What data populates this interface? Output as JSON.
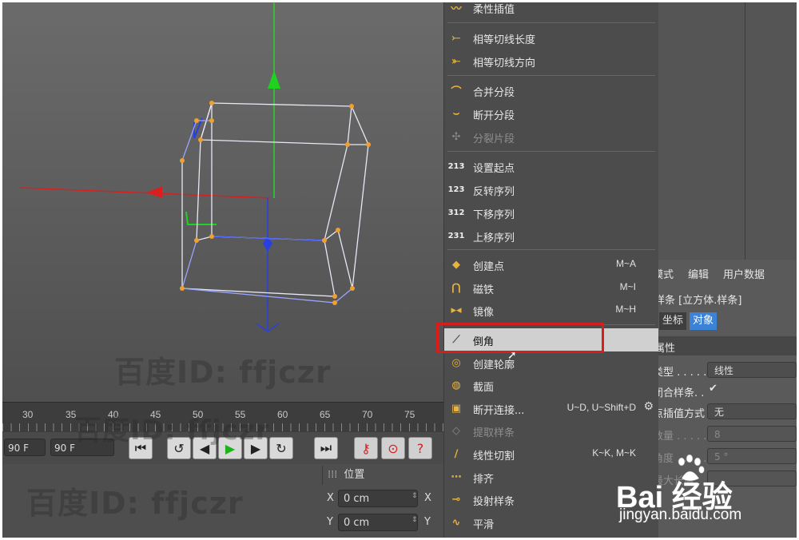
{
  "viewport": {
    "watermarks": [
      "百度ID: ffjczr",
      "百度ID: ffjczr",
      "百度ID: ffjczr"
    ]
  },
  "timeline": {
    "ticks": [
      "30",
      "35",
      "40",
      "45",
      "50",
      "55",
      "60",
      "65",
      "70",
      "75"
    ]
  },
  "controls": {
    "frame_start": "90 F",
    "frame_end": "90 F"
  },
  "coords": {
    "header": "位置",
    "rows": [
      {
        "axis": "X",
        "value": "0 cm"
      },
      {
        "axis": "Y",
        "value": "0 cm"
      }
    ]
  },
  "menu": {
    "items": [
      {
        "label": "柔性插值",
        "shortcut": "",
        "icon": "spline-soft-icon",
        "glyph": "〰",
        "disabled": false
      },
      {
        "label": "相等切线长度",
        "shortcut": "",
        "icon": "equal-tangent-length-icon",
        "glyph": "⤚",
        "disabled": false
      },
      {
        "label": "相等切线方向",
        "shortcut": "",
        "icon": "equal-tangent-direction-icon",
        "glyph": "⤜",
        "disabled": false
      },
      {
        "label": "合并分段",
        "shortcut": "",
        "icon": "join-segment-icon",
        "glyph": "⌒",
        "disabled": false
      },
      {
        "label": "断开分段",
        "shortcut": "",
        "icon": "break-segment-icon",
        "glyph": "⌣",
        "disabled": false
      },
      {
        "label": "分裂片段",
        "shortcut": "",
        "icon": "explode-segments-icon",
        "glyph": "✣",
        "disabled": true
      },
      {
        "label": "设置起点",
        "shortcut": "",
        "icon": "set-first-point-icon",
        "glyph": "213",
        "disabled": false
      },
      {
        "label": "反转序列",
        "shortcut": "",
        "icon": "reverse-sequence-icon",
        "glyph": "123",
        "disabled": false
      },
      {
        "label": "下移序列",
        "shortcut": "",
        "icon": "move-down-sequence-icon",
        "glyph": "312",
        "disabled": false
      },
      {
        "label": "上移序列",
        "shortcut": "",
        "icon": "move-up-sequence-icon",
        "glyph": "231",
        "disabled": false
      },
      {
        "label": "创建点",
        "shortcut": "M~A",
        "icon": "create-point-icon",
        "glyph": "◆",
        "disabled": false
      },
      {
        "label": "磁铁",
        "shortcut": "M~I",
        "icon": "magnet-icon",
        "glyph": "⋂",
        "disabled": false
      },
      {
        "label": "镜像",
        "shortcut": "M~H",
        "icon": "mirror-icon",
        "glyph": "▸◂",
        "disabled": false
      },
      {
        "label": "倒角",
        "shortcut": "",
        "icon": "chamfer-icon",
        "glyph": "⟋",
        "disabled": false,
        "highlighted": true
      },
      {
        "label": "创建轮廓",
        "shortcut": "",
        "icon": "create-outline-icon",
        "glyph": "◎",
        "disabled": false
      },
      {
        "label": "截面",
        "shortcut": "",
        "icon": "cross-section-icon",
        "glyph": "◍",
        "disabled": false
      },
      {
        "label": "断开连接...",
        "shortcut": "U~D, U~Shift+D",
        "icon": "disconnect-icon",
        "glyph": "▣",
        "disabled": false
      },
      {
        "label": "提取样条",
        "shortcut": "",
        "icon": "extract-spline-icon",
        "glyph": "◇",
        "disabled": true
      },
      {
        "label": "线性切割",
        "shortcut": "K~K, M~K",
        "icon": "knife-icon",
        "glyph": "∕",
        "disabled": false
      },
      {
        "label": "排齐",
        "shortcut": "",
        "icon": "align-icon",
        "glyph": "⋯",
        "disabled": false
      },
      {
        "label": "投射样条",
        "shortcut": "",
        "icon": "project-spline-icon",
        "glyph": "⊸",
        "disabled": false
      },
      {
        "label": "平滑",
        "shortcut": "",
        "icon": "smooth-icon",
        "glyph": "∿",
        "disabled": false
      }
    ]
  },
  "attributes": {
    "tabs": [
      "模式",
      "编辑",
      "用户数据"
    ],
    "object_title": "样条 [立方体.样条]",
    "subtabs": [
      "坐标",
      "对象"
    ],
    "section": "属性",
    "fields": [
      {
        "label": "类型 . . . . .",
        "value": "线性",
        "disabled": false
      },
      {
        "label": "闭合样条. .",
        "value": "✔",
        "disabled": false
      },
      {
        "label": "点插值方式",
        "value": "无",
        "disabled": false
      },
      {
        "label": "数量 . . . . .",
        "value": "8",
        "disabled": true
      },
      {
        "label": "角度 . . . . .",
        "value": "5 °",
        "disabled": true
      },
      {
        "label": "最大长度",
        "value": "",
        "disabled": true
      }
    ]
  },
  "brand": {
    "logo_text": "Bai 经验",
    "url": "jingyan.baidu.com"
  },
  "colors": {
    "highlight_box": "#d91c1c",
    "axis_x": "#d82020",
    "axis_y": "#1fd21f",
    "axis_z": "#2a3fe0",
    "point": "#f0a030"
  }
}
